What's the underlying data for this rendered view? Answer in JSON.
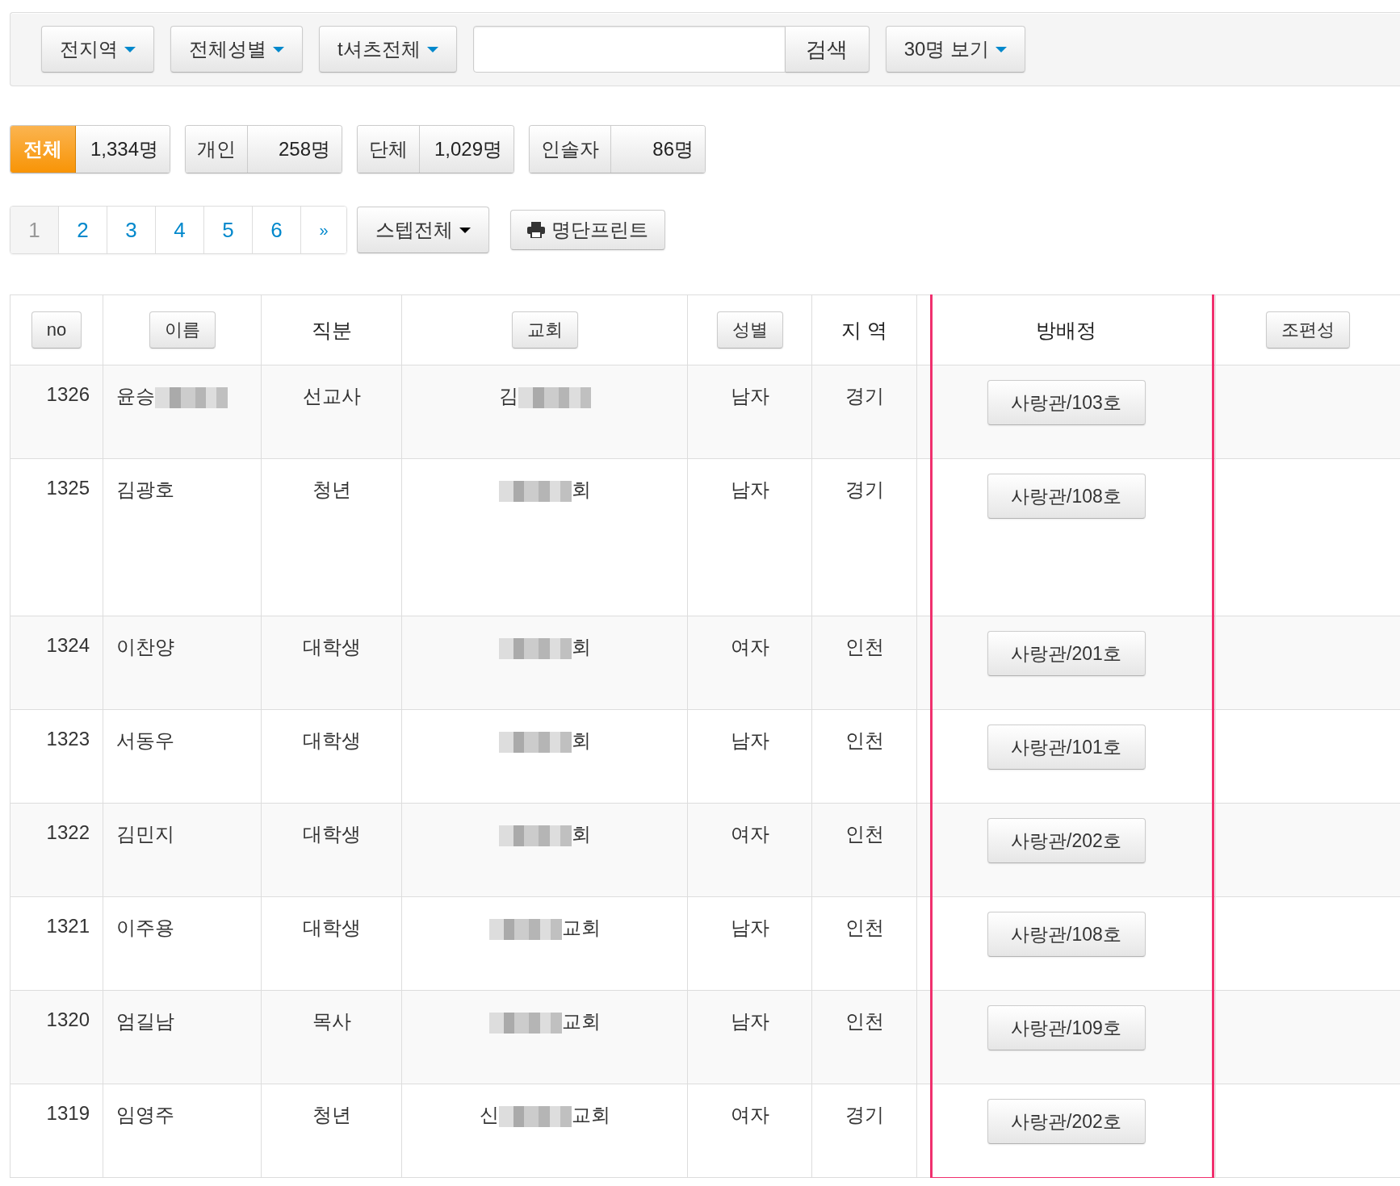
{
  "filters": [
    {
      "label": "전지역"
    },
    {
      "label": "전체성별"
    },
    {
      "label": "t셔츠전체"
    }
  ],
  "search": {
    "button": "검색"
  },
  "page_size": {
    "label": "30명 보기"
  },
  "counts": [
    {
      "label": "전체",
      "value": "1,334명",
      "selected": true
    },
    {
      "label": "개인",
      "value": "258명",
      "selected": false
    },
    {
      "label": "단체",
      "value": "1,029명",
      "selected": false
    },
    {
      "label": "인솔자",
      "value": "86명",
      "selected": false
    }
  ],
  "pagination": {
    "pages": [
      {
        "label": "1",
        "selected": true
      },
      {
        "label": "2",
        "selected": false
      },
      {
        "label": "3",
        "selected": false
      },
      {
        "label": "4",
        "selected": false
      },
      {
        "label": "5",
        "selected": false
      },
      {
        "label": "6",
        "selected": false
      }
    ],
    "next": "»"
  },
  "step_filter": {
    "label": "스텝전체"
  },
  "print_button": {
    "label": "명단프린트"
  },
  "table": {
    "columns": [
      {
        "label": "no",
        "kind": "button",
        "highlighted": false
      },
      {
        "label": "이름",
        "kind": "button",
        "highlighted": false
      },
      {
        "label": "직분",
        "kind": "text",
        "highlighted": false
      },
      {
        "label": "교회",
        "kind": "button",
        "highlighted": false
      },
      {
        "label": "성별",
        "kind": "button",
        "highlighted": false
      },
      {
        "label": "지 역",
        "kind": "text",
        "highlighted": false
      },
      {
        "label": "방배정",
        "kind": "text",
        "highlighted": true
      },
      {
        "label": "조편성",
        "kind": "button",
        "highlighted": false
      }
    ],
    "rows": [
      {
        "no": "1326",
        "name": [
          {
            "kind": "text",
            "text": "윤승"
          },
          {
            "kind": "blur"
          }
        ],
        "position": "선교사",
        "church": [
          {
            "kind": "text",
            "text": "김"
          },
          {
            "kind": "blur"
          }
        ],
        "gender": "남자",
        "region": "경기",
        "room": "사랑관/103호"
      },
      {
        "no": "1325",
        "name": [
          {
            "kind": "text",
            "text": "김광호"
          }
        ],
        "position": "청년",
        "church": [
          {
            "kind": "blur"
          },
          {
            "kind": "text",
            "text": "회"
          }
        ],
        "gender": "남자",
        "region": "경기",
        "room": "사랑관/108호"
      },
      {
        "no": "1324",
        "name": [
          {
            "kind": "text",
            "text": "이찬양"
          }
        ],
        "position": "대학생",
        "church": [
          {
            "kind": "blur"
          },
          {
            "kind": "text",
            "text": "회"
          }
        ],
        "gender": "여자",
        "region": "인천",
        "room": "사랑관/201호"
      },
      {
        "no": "1323",
        "name": [
          {
            "kind": "text",
            "text": "서동우"
          }
        ],
        "position": "대학생",
        "church": [
          {
            "kind": "blur"
          },
          {
            "kind": "text",
            "text": "회"
          }
        ],
        "gender": "남자",
        "region": "인천",
        "room": "사랑관/101호"
      },
      {
        "no": "1322",
        "name": [
          {
            "kind": "text",
            "text": "김민지"
          }
        ],
        "position": "대학생",
        "church": [
          {
            "kind": "blur"
          },
          {
            "kind": "text",
            "text": "회"
          }
        ],
        "gender": "여자",
        "region": "인천",
        "room": "사랑관/202호"
      },
      {
        "no": "1321",
        "name": [
          {
            "kind": "text",
            "text": "이주용"
          }
        ],
        "position": "대학생",
        "church": [
          {
            "kind": "blur"
          },
          {
            "kind": "text",
            "text": "교회"
          }
        ],
        "gender": "남자",
        "region": "인천",
        "room": "사랑관/108호"
      },
      {
        "no": "1320",
        "name": [
          {
            "kind": "text",
            "text": "엄길남"
          }
        ],
        "position": "목사",
        "church": [
          {
            "kind": "blur"
          },
          {
            "kind": "text",
            "text": "교회"
          }
        ],
        "gender": "남자",
        "region": "인천",
        "room": "사랑관/109호"
      },
      {
        "no": "1319",
        "name": [
          {
            "kind": "text",
            "text": "임영주"
          }
        ],
        "position": "청년",
        "church": [
          {
            "kind": "text",
            "text": "신"
          },
          {
            "kind": "blur"
          },
          {
            "kind": "text",
            "text": "교회"
          }
        ],
        "gender": "여자",
        "region": "경기",
        "room": "사랑관/202호"
      }
    ]
  }
}
